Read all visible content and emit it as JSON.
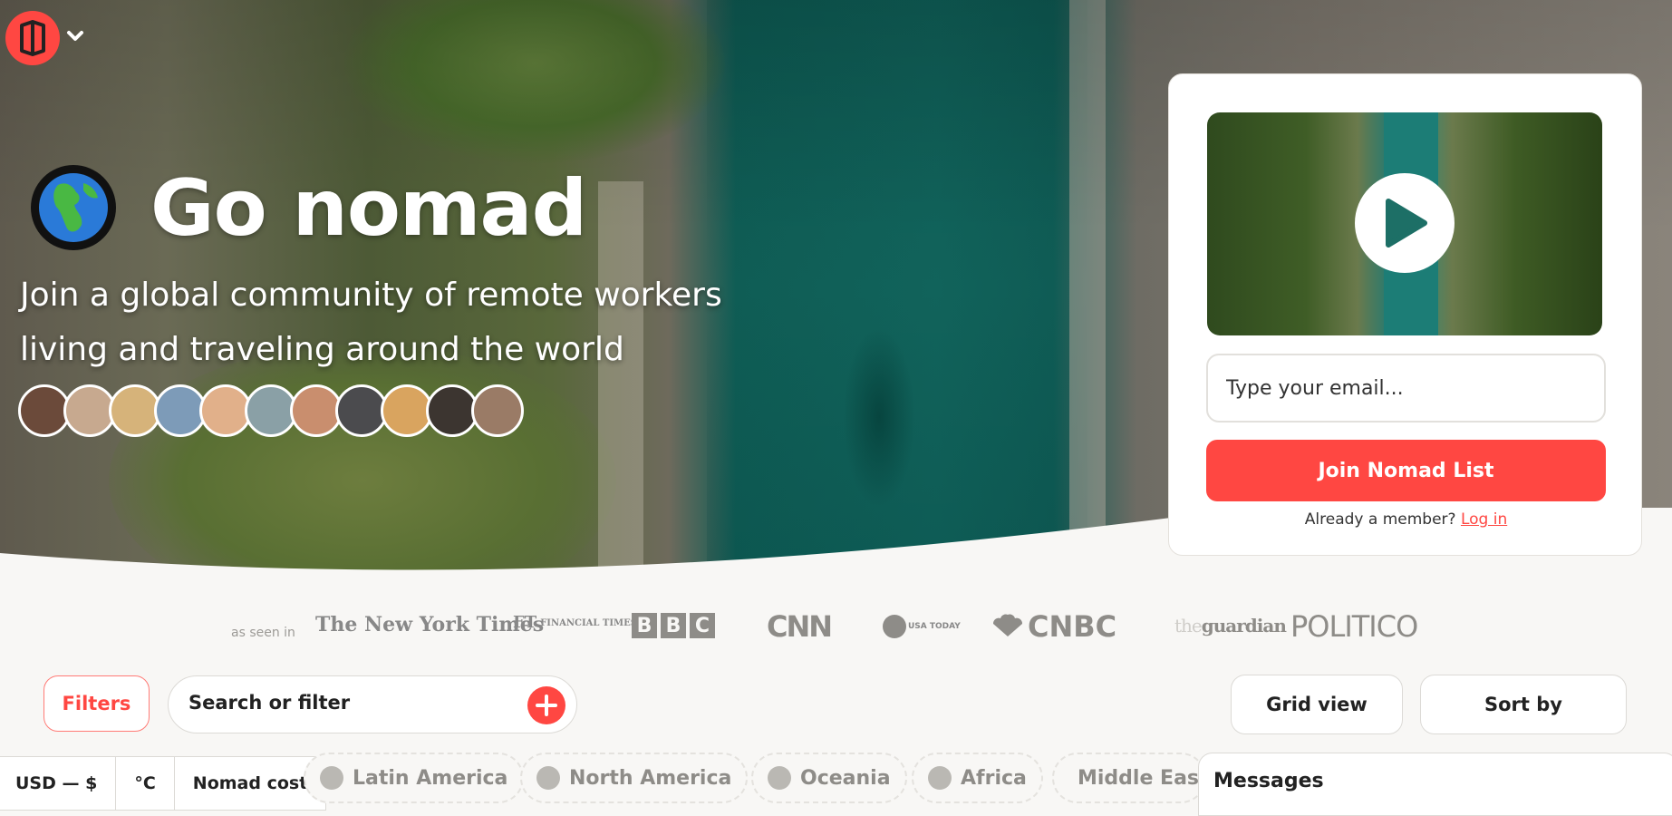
{
  "hero": {
    "title": "Go nomad",
    "subtitle": "Join a global community of remote workers living and traveling around the world",
    "avatar_count": 11
  },
  "signup": {
    "email_placeholder": "Type your email...",
    "join_label": "Join Nomad List",
    "member_prompt": "Already a member?",
    "login_label": "Log in"
  },
  "press": {
    "label": "as seen in",
    "logos": [
      "The New York Times",
      "FT",
      "FINANCIAL TIMES",
      "B",
      "B",
      "C",
      "CNN",
      "USA TODAY",
      "CNBC",
      "the",
      "guardian",
      "POLITICO"
    ]
  },
  "toolbar": {
    "filters_label": "Filters",
    "search_label": "Search or filter",
    "grid_view_label": "Grid view",
    "sort_by_label": "Sort by"
  },
  "units": {
    "currency": "USD — $",
    "temperature": "°C",
    "cost": "Nomad cost"
  },
  "regions": [
    "Latin America",
    "North America",
    "Oceania",
    "Africa",
    "Middle East"
  ],
  "messages": {
    "title": "Messages"
  },
  "colors": {
    "brand": "#ff4742",
    "page_bg": "#f8f7f5"
  }
}
